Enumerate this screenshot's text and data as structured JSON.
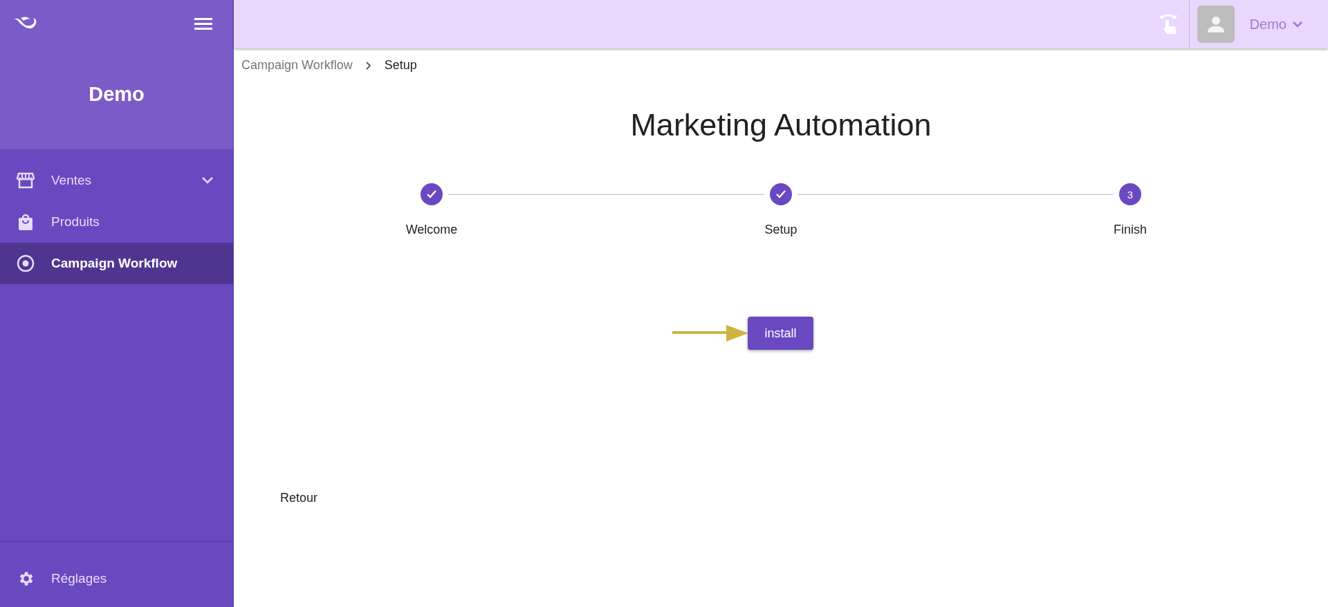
{
  "sidebar": {
    "title": "Demo",
    "items": [
      {
        "label": "Ventes",
        "expandable": true,
        "selected": false
      },
      {
        "label": "Produits",
        "expandable": false,
        "selected": false
      },
      {
        "label": "Campaign Workflow",
        "expandable": false,
        "selected": true
      }
    ],
    "footer_item": {
      "label": "Réglages"
    }
  },
  "topbar": {
    "user": "Demo"
  },
  "breadcrumb": [
    "Campaign Workflow",
    "Setup"
  ],
  "page_title": "Marketing Automation",
  "steps": [
    {
      "label": "Welcome",
      "completed": true
    },
    {
      "label": "Setup",
      "completed": true
    },
    {
      "label": "Finish",
      "completed": false,
      "number": "3"
    }
  ],
  "primary_button": "install",
  "back_link": "Retour"
}
